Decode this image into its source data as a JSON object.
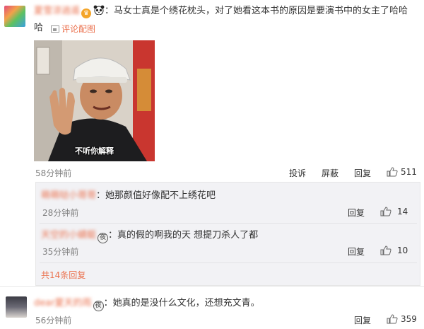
{
  "top_comment": {
    "user_name": "夏雪涼逍遥",
    "text": "：马女士真是个绣花枕头，对了她看这本书的原因是要演书中的女主了哈哈",
    "text_cont": "哈",
    "picture_link": "评论配图",
    "meme_caption": "不听你解释",
    "time": "58分钟前",
    "actions": {
      "report": "投诉",
      "block": "屏蔽",
      "reply": "回复"
    },
    "likes": "511"
  },
  "replies": [
    {
      "user_name": "萌萌哒小哥哥",
      "text": "：她那颜值好像配不上绣花吧",
      "time": "28分钟前",
      "reply": "回复",
      "likes": "14"
    },
    {
      "user_name": "天空的小蜻蜓",
      "text": "：真的假的啊我的天 想提刀杀人了都",
      "time": "35分钟前",
      "reply": "回复",
      "likes": "10"
    }
  ],
  "more_replies": "共14条回复",
  "bottom_comment": {
    "user_name": "dear夏天的雨",
    "text": "：她真的是没什么文化，还想充文青。",
    "time": "56分钟前",
    "reply": "回复",
    "likes": "359"
  },
  "colors": {
    "accent": "#eb7350",
    "reply_bg": "#f2f2f5",
    "meta": "#808080"
  },
  "icons": [
    "vip-icon",
    "panda-icon",
    "picture-icon",
    "thumbs-up-icon",
    "night-mode-icon"
  ]
}
